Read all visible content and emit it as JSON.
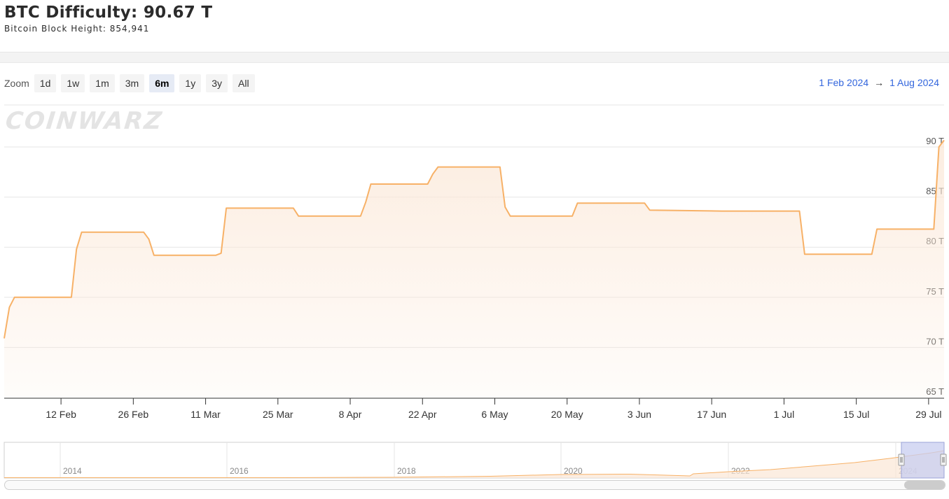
{
  "header": {
    "title": "BTC Difficulty: 90.67 T",
    "subtitle": "Bitcoin Block Height: 854,941"
  },
  "zoom": {
    "label": "Zoom",
    "buttons": [
      "1d",
      "1w",
      "1m",
      "3m",
      "6m",
      "1y",
      "3y",
      "All"
    ],
    "active": "6m"
  },
  "range": {
    "from": "1 Feb 2024",
    "arrow": "→",
    "to": "1 Aug 2024"
  },
  "watermark": "COINWARZ",
  "colors": {
    "line": "#f7b167",
    "fill_top": "#fbe7d6",
    "accent": "#3366dd",
    "nav_mask": "#c8cdf0"
  },
  "chart_data": {
    "type": "area",
    "ylim": [
      65,
      90
    ],
    "xlim": [
      "2024-02-01",
      "2024-08-01"
    ],
    "yticks": [
      {
        "value": 65,
        "label": "65 T"
      },
      {
        "value": 70,
        "label": "70 T"
      },
      {
        "value": 75,
        "label": "75 T"
      },
      {
        "value": 80,
        "label": "80 T"
      },
      {
        "value": 85,
        "label": "85 T"
      },
      {
        "value": 90,
        "label": "90 T"
      }
    ],
    "xticks": [
      {
        "date": "2024-02-12",
        "label": "12 Feb"
      },
      {
        "date": "2024-02-26",
        "label": "26 Feb"
      },
      {
        "date": "2024-03-11",
        "label": "11 Mar"
      },
      {
        "date": "2024-03-25",
        "label": "25 Mar"
      },
      {
        "date": "2024-04-08",
        "label": "8 Apr"
      },
      {
        "date": "2024-04-22",
        "label": "22 Apr"
      },
      {
        "date": "2024-05-06",
        "label": "6 May"
      },
      {
        "date": "2024-05-20",
        "label": "20 May"
      },
      {
        "date": "2024-06-03",
        "label": "3 Jun"
      },
      {
        "date": "2024-06-17",
        "label": "17 Jun"
      },
      {
        "date": "2024-07-01",
        "label": "1 Jul"
      },
      {
        "date": "2024-07-15",
        "label": "15 Jul"
      },
      {
        "date": "2024-07-29",
        "label": "29 Jul"
      }
    ],
    "series": [
      {
        "points": [
          [
            "2024-02-01",
            70.9
          ],
          [
            "2024-02-02",
            74.0
          ],
          [
            "2024-02-03",
            75.0
          ],
          [
            "2024-02-14",
            75.0
          ],
          [
            "2024-02-15",
            79.8
          ],
          [
            "2024-02-16",
            81.5
          ],
          [
            "2024-02-28",
            81.5
          ],
          [
            "2024-02-29",
            80.8
          ],
          [
            "2024-03-01",
            79.2
          ],
          [
            "2024-03-13",
            79.2
          ],
          [
            "2024-03-14",
            79.4
          ],
          [
            "2024-03-15",
            83.9
          ],
          [
            "2024-03-28",
            83.9
          ],
          [
            "2024-03-29",
            83.1
          ],
          [
            "2024-04-10",
            83.1
          ],
          [
            "2024-04-11",
            84.5
          ],
          [
            "2024-04-12",
            86.3
          ],
          [
            "2024-04-23",
            86.3
          ],
          [
            "2024-04-24",
            87.3
          ],
          [
            "2024-04-25",
            88.0
          ],
          [
            "2024-05-07",
            88.0
          ],
          [
            "2024-05-08",
            84.0
          ],
          [
            "2024-05-09",
            83.1
          ],
          [
            "2024-05-21",
            83.1
          ],
          [
            "2024-05-22",
            84.4
          ],
          [
            "2024-06-04",
            84.4
          ],
          [
            "2024-06-05",
            83.7
          ],
          [
            "2024-06-19",
            83.6
          ],
          [
            "2024-07-04",
            83.6
          ],
          [
            "2024-07-05",
            79.3
          ],
          [
            "2024-07-18",
            79.3
          ],
          [
            "2024-07-19",
            81.8
          ],
          [
            "2024-07-30",
            81.8
          ],
          [
            "2024-07-31",
            90.0
          ],
          [
            "2024-08-01",
            90.67
          ]
        ]
      }
    ],
    "navigator": {
      "year_labels": [
        "2014",
        "2016",
        "2018",
        "2020",
        "2022",
        "2024"
      ]
    }
  }
}
